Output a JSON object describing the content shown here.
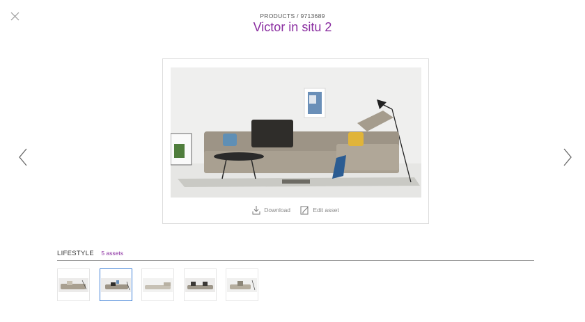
{
  "header": {
    "breadcrumb_section": "PRODUCTS",
    "breadcrumb_sep": "/",
    "breadcrumb_id": "9713689",
    "title": "Victor in situ 2"
  },
  "icons": {
    "close": "close-icon",
    "prev": "chevron-left-icon",
    "next": "chevron-right-icon",
    "download": "download-icon",
    "edit": "edit-icon"
  },
  "actions": {
    "download_label": "Download",
    "edit_label": "Edit asset"
  },
  "collection": {
    "title": "LIFESTYLE",
    "count": "5 assets",
    "thumbnails": [
      {
        "selected": false
      },
      {
        "selected": true
      },
      {
        "selected": false
      },
      {
        "selected": false
      },
      {
        "selected": false
      }
    ]
  },
  "colors": {
    "accent": "#8a2da0",
    "selection": "#3d7fd6"
  }
}
